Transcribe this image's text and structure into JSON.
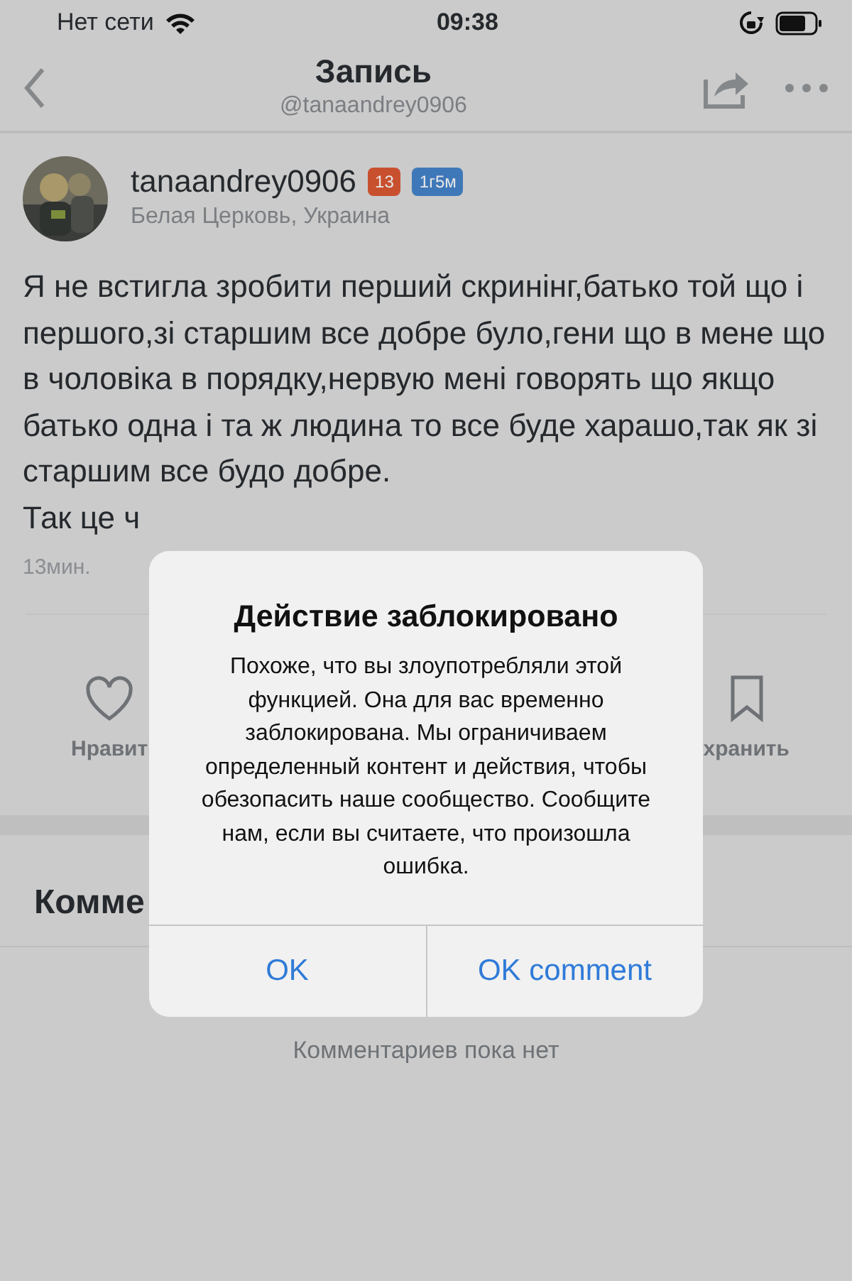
{
  "status_bar": {
    "carrier": "Нет сети",
    "time": "09:38"
  },
  "nav": {
    "title": "Запись",
    "subtitle": "@tanaandrey0906"
  },
  "post": {
    "author": "tanaandrey0906",
    "badges": [
      {
        "text": "13",
        "color": "#c8502f"
      },
      {
        "text": "1г5м",
        "color": "#3f78b8"
      }
    ],
    "location": "Белая Церковь, Украина",
    "text": "Я не встигла зробити перший скринінг,батько той що і першого,зі старшим все добре було,гени що в мене що в чоловіка в порядку,нервую мені говорять що якщо батько одна і та ж людина то все буде харашо,так як зі старшим все будо добре.",
    "text_cut": "Так це ч",
    "time": "13мин.",
    "actions": [
      {
        "kind": "like",
        "label": "Нравит"
      },
      {
        "kind": "save",
        "label": "хранить"
      }
    ]
  },
  "comments": {
    "heading": "Комме",
    "empty": "Комментариев пока нет"
  },
  "alert": {
    "title": "Действие заблокировано",
    "message": "Похоже, что вы злоупотребляли этой функцией. Она для вас временно заблокирована. Мы ограничиваем определенный контент и действия, чтобы обезопасить наше сообщество. Сообщите нам, если вы считаете, что произошла ошибка.",
    "buttons": [
      "OK",
      "OK comment"
    ]
  }
}
